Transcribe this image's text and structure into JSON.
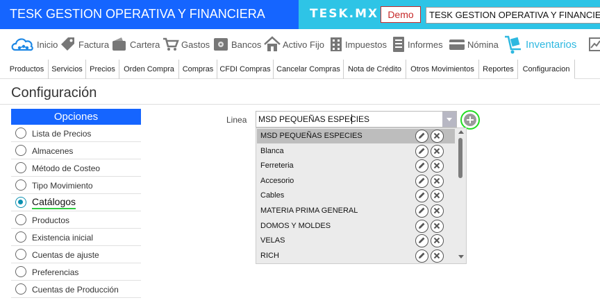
{
  "header": {
    "company_title": "TESK GESTION OPERATIVA Y FINANCIERA",
    "brand": "TESK.MX",
    "demo_label": "Demo",
    "company_selector_value": "TESK GESTION OPERATIVA Y FINANCIERA"
  },
  "modules": [
    {
      "label": "Inicio",
      "icon": "cloud-icon"
    },
    {
      "label": "Factura",
      "icon": "tag-icon"
    },
    {
      "label": "Cartera",
      "icon": "wallet-icon"
    },
    {
      "label": "Gastos",
      "icon": "cart-icon"
    },
    {
      "label": "Bancos",
      "icon": "safe-icon"
    },
    {
      "label": "Activo Fijo",
      "icon": "house-icon"
    },
    {
      "label": "Impuestos",
      "icon": "building-icon"
    },
    {
      "label": "Informes",
      "icon": "document-icon"
    },
    {
      "label": "Nómina",
      "icon": "card-icon"
    },
    {
      "label": "Inventarios",
      "icon": "inventory-icon",
      "active": true
    }
  ],
  "tabs": [
    {
      "label": "Productos"
    },
    {
      "label": "Servicios"
    },
    {
      "label": "Precios"
    },
    {
      "label": "Orden Compra"
    },
    {
      "label": "Compras"
    },
    {
      "label": "CFDI Compras"
    },
    {
      "label": "Cancelar Compras"
    },
    {
      "label": "Nota de Crédito"
    },
    {
      "label": "Otros Movimientos"
    },
    {
      "label": "Reportes"
    },
    {
      "label": "Configuracion",
      "active": true
    }
  ],
  "page": {
    "title": "Configuración"
  },
  "options_panel": {
    "header": "Opciones",
    "items": [
      {
        "label": "Lista de Precios"
      },
      {
        "label": "Almacenes"
      },
      {
        "label": "Método de Costeo"
      },
      {
        "label": "Tipo Movimiento"
      },
      {
        "label": "Catálogos",
        "selected": true
      },
      {
        "label": "Productos"
      },
      {
        "label": "Existencia inicial"
      },
      {
        "label": "Cuentas de ajuste"
      },
      {
        "label": "Preferencias"
      },
      {
        "label": "Cuentas de Producción"
      }
    ]
  },
  "linea": {
    "label": "Linea",
    "value": "MSD PEQUEÑAS ESPECIES",
    "options": [
      "MSD PEQUEÑAS ESPECIES",
      "Blanca",
      "Ferreteria",
      "Accesorio",
      "Cables",
      "MATERIA PRIMA GENERAL",
      "DOMOS Y MOLDES",
      "VELAS",
      "RICH"
    ]
  },
  "colors": {
    "primary_blue": "#1565ff",
    "brand_cyan": "#2ec4e6",
    "active_module": "#2eb8e0",
    "radio_checked": "#0a8fb0",
    "add_highlight": "#22dd22"
  }
}
